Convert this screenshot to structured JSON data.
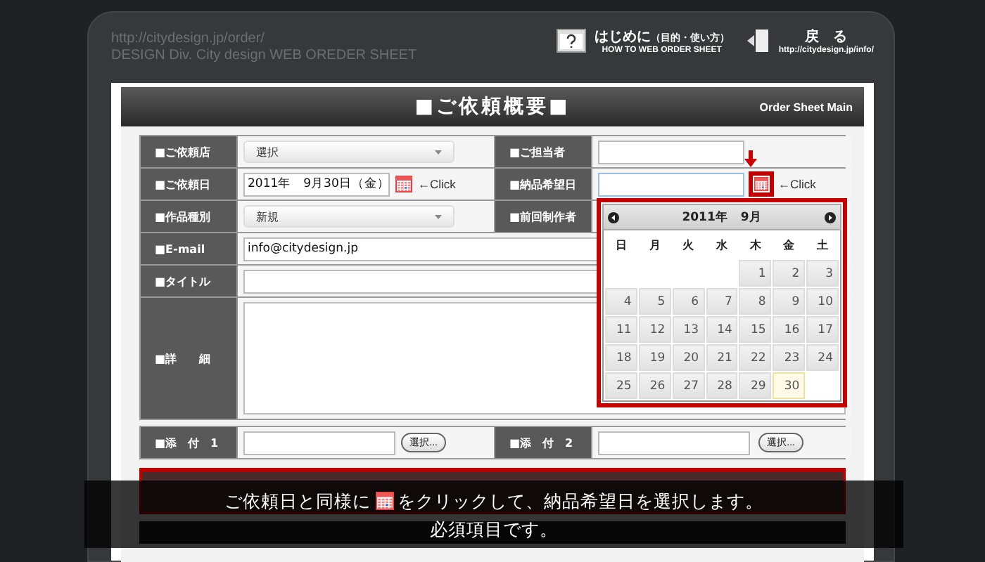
{
  "header": {
    "url": "http://citydesign.jp/order/",
    "subtitle": "DESIGN Div. City design WEB OREDER SHEET",
    "help_link": {
      "title": "はじめに",
      "note": "（目的・使い方）",
      "caption": "HOW TO WEB ORDER SHEET"
    },
    "back_link": {
      "title": "戻　る",
      "caption": "http://citydesign.jp/info/"
    }
  },
  "sheet": {
    "title": "■ご依頼概要■",
    "tag": "Order Sheet Main"
  },
  "form": {
    "shop": {
      "label": "■ご依頼店",
      "value": "選択"
    },
    "person": {
      "label": "■ご担当者"
    },
    "request_date": {
      "label": "■ご依頼日",
      "value": "2011年　9月30日（金）",
      "hint": "←Click"
    },
    "delivery_date": {
      "label": "■納品希望日",
      "hint": "←Click",
      "calendar_open": true
    },
    "work_type": {
      "label": "■作品種別",
      "value": "新規"
    },
    "previous_author": {
      "label": "■前回制作者"
    },
    "email": {
      "label": "■E-mail",
      "value": "info@citydesign.jp"
    },
    "title": {
      "label": "■タイトル"
    },
    "details": {
      "label": "■詳　　細"
    },
    "attachments": [
      {
        "label": "■添　付　1",
        "button": "選択..."
      },
      {
        "label": "■添　付　2",
        "button": "選択..."
      }
    ]
  },
  "calendar": {
    "title": "2011年　9月",
    "weekdays": [
      "日",
      "月",
      "火",
      "水",
      "木",
      "金",
      "土"
    ],
    "weeks": [
      [
        {
          "kind": "blank"
        },
        {
          "kind": "blank"
        },
        {
          "kind": "blank"
        },
        {
          "kind": "blank"
        },
        {
          "label": "1",
          "highlighted": false
        },
        {
          "label": "2",
          "highlighted": false
        },
        {
          "label": "3",
          "highlighted": false
        }
      ],
      [
        {
          "label": "4",
          "highlighted": false
        },
        {
          "label": "5",
          "highlighted": false
        },
        {
          "label": "6",
          "highlighted": false
        },
        {
          "label": "7",
          "highlighted": false
        },
        {
          "label": "8",
          "highlighted": false
        },
        {
          "label": "9",
          "highlighted": false
        },
        {
          "label": "10",
          "highlighted": false
        }
      ],
      [
        {
          "label": "11",
          "highlighted": false
        },
        {
          "label": "12",
          "highlighted": false
        },
        {
          "label": "13",
          "highlighted": false
        },
        {
          "label": "14",
          "highlighted": false
        },
        {
          "label": "15",
          "highlighted": false
        },
        {
          "label": "16",
          "highlighted": false
        },
        {
          "label": "17",
          "highlighted": false
        }
      ],
      [
        {
          "label": "18",
          "highlighted": false
        },
        {
          "label": "19",
          "highlighted": false
        },
        {
          "label": "20",
          "highlighted": false
        },
        {
          "label": "21",
          "highlighted": false
        },
        {
          "label": "22",
          "highlighted": false
        },
        {
          "label": "23",
          "highlighted": false
        },
        {
          "label": "24",
          "highlighted": false
        }
      ],
      [
        {
          "label": "25",
          "highlighted": false
        },
        {
          "label": "26",
          "highlighted": false
        },
        {
          "label": "27",
          "highlighted": false
        },
        {
          "label": "28",
          "highlighted": false
        },
        {
          "label": "29",
          "highlighted": false
        },
        {
          "label": "30",
          "highlighted": true
        },
        {
          "kind": "blank"
        }
      ]
    ]
  },
  "caption": {
    "before_icon": "ご依頼日と同様に",
    "after_icon": "をクリックして、納品希望日を選択します。",
    "line_2": "必須項目です。"
  }
}
